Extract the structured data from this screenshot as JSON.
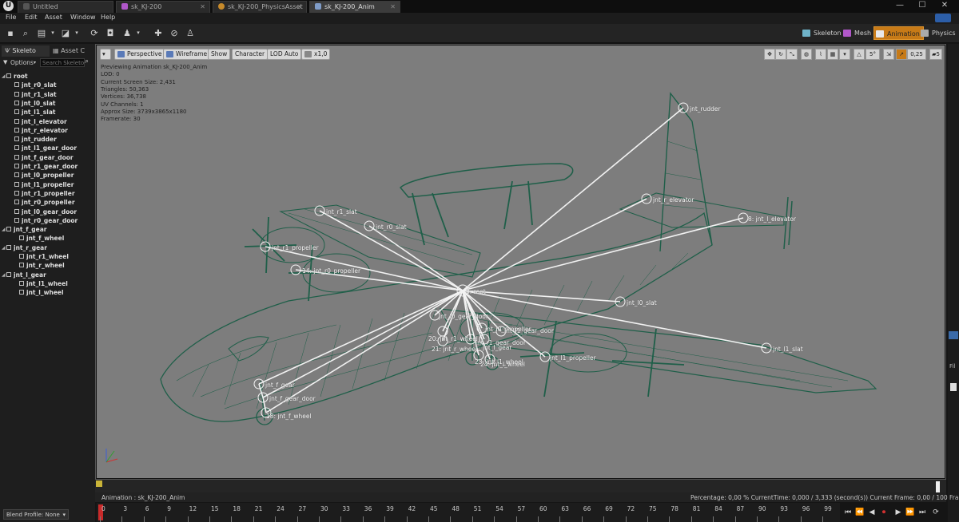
{
  "window": {
    "tabs": [
      {
        "label": "Untitled",
        "color": "#555555"
      },
      {
        "label": "sk_KJ-200",
        "color": "#b057c9"
      },
      {
        "label": "sk_KJ-200_PhysicsAsset",
        "color": "#c78a2a"
      },
      {
        "label": "sk_KJ-200_Anim",
        "color": "#7f9cc8"
      }
    ],
    "controls": [
      "—",
      "☐",
      "✕"
    ]
  },
  "menu": [
    "File",
    "Edit",
    "Asset",
    "Window",
    "Help"
  ],
  "modes": [
    "Skeleton",
    "Mesh",
    "Animation",
    "Physics"
  ],
  "left_panel": {
    "tabs": [
      "Skeleto",
      "Asset C"
    ],
    "options_label": "Options",
    "search_placeholder": "Search Skeleto",
    "tree": [
      {
        "label": "root",
        "depth": 0
      },
      {
        "label": "jnt_r0_slat",
        "depth": 1
      },
      {
        "label": "jnt_r1_slat",
        "depth": 1
      },
      {
        "label": "jnt_l0_slat",
        "depth": 1
      },
      {
        "label": "jnt_l1_slat",
        "depth": 1
      },
      {
        "label": "jnt_l_elevator",
        "depth": 1
      },
      {
        "label": "jnt_r_elevator",
        "depth": 1
      },
      {
        "label": "jnt_rudder",
        "depth": 1
      },
      {
        "label": "jnt_l1_gear_door",
        "depth": 1
      },
      {
        "label": "jnt_f_gear_door",
        "depth": 1
      },
      {
        "label": "jnt_r1_gear_door",
        "depth": 1
      },
      {
        "label": "jnt_l0_propeller",
        "depth": 1
      },
      {
        "label": "jnt_l1_propeller",
        "depth": 1
      },
      {
        "label": "jnt_r1_propeller",
        "depth": 1
      },
      {
        "label": "jnt_r0_propeller",
        "depth": 1
      },
      {
        "label": "jnt_l0_gear_door",
        "depth": 1
      },
      {
        "label": "jnt_r0_gear_door",
        "depth": 1
      },
      {
        "label": "jnt_f_gear",
        "depth": 0
      },
      {
        "label": "jnt_f_wheel",
        "depth": 2
      },
      {
        "label": "jnt_r_gear",
        "depth": 0
      },
      {
        "label": "jnt_r1_wheel",
        "depth": 2
      },
      {
        "label": "jnt_r_wheel",
        "depth": 2
      },
      {
        "label": "jnt_l_gear",
        "depth": 0
      },
      {
        "label": "jnt_l1_wheel",
        "depth": 2
      },
      {
        "label": "jnt_l_wheel",
        "depth": 2
      }
    ],
    "blend_profile": "Blend Profile: None"
  },
  "viewport": {
    "buttons": [
      "Perspective",
      "Wireframe",
      "Show",
      "Character",
      "LOD Auto",
      "x1,0"
    ],
    "right_values": {
      "angle": "5°",
      "scale": "0,25",
      "speed": "5"
    },
    "info": [
      "Previewing Animation sk_KJ-200_Anim",
      "LOD: 0",
      "Current Screen Size: 2,431",
      "Triangles: 50,363",
      "Vertices: 36,738",
      "UV Channels: 1",
      "Approx Size: 3739x3865x1180",
      "Framerate: 30"
    ],
    "bone_labels": [
      {
        "text": "jnt_rudder"
      },
      {
        "text": "jnt_r1_slat"
      },
      {
        "text": "jnt_r0_slat"
      },
      {
        "text": "jnt_r_elevator"
      },
      {
        "text": "8: jnt_l_elevator"
      },
      {
        "text": "jnt_r1_propeller"
      },
      {
        "text": "14: jnt_r0_propeller"
      },
      {
        "text": "0: root"
      },
      {
        "text": "jnt_l0_slat"
      },
      {
        "text": "jnt_l0_gear_door"
      },
      {
        "text": "jnt_l0_propeller"
      },
      {
        "text": "jnt_l1_gear_door"
      },
      {
        "text": "20: jnt_r1_wheel"
      },
      {
        "text": "jnt_r1_gear_door"
      },
      {
        "text": "jnt_l_gear"
      },
      {
        "text": "21: jnt_r_wheel"
      },
      {
        "text": "23: jnt_l1_wheel"
      },
      {
        "text": "24: jnt_l_wheel"
      },
      {
        "text": "jnt_l1_propeller"
      },
      {
        "text": "jnt_l1_slat"
      },
      {
        "text": "jnt_f_gear"
      },
      {
        "text": "jnt_f_gear_door"
      },
      {
        "text": "18: jnt_f_wheel"
      }
    ]
  },
  "timeline": {
    "animation_label": "Animation : sk_KJ-200_Anim",
    "status": "Percentage: 0,00 % CurrentTime: 0,000 / 3,333 (second(s)) Current Frame: 0,00 / 100 Fram",
    "ticks": [
      "0",
      "3",
      "6",
      "9",
      "12",
      "15",
      "18",
      "21",
      "24",
      "27",
      "30",
      "33",
      "36",
      "39",
      "42",
      "45",
      "48",
      "51",
      "54",
      "57",
      "60",
      "63",
      "66",
      "69",
      "72",
      "75",
      "78",
      "81",
      "84",
      "87",
      "90",
      "93",
      "96",
      "99"
    ]
  },
  "colors": {
    "mode_active": "#c77a17",
    "viewport_bg": "#7d7d7d",
    "wireframe": "#1f5f49",
    "bone": "#f2f2f2"
  }
}
